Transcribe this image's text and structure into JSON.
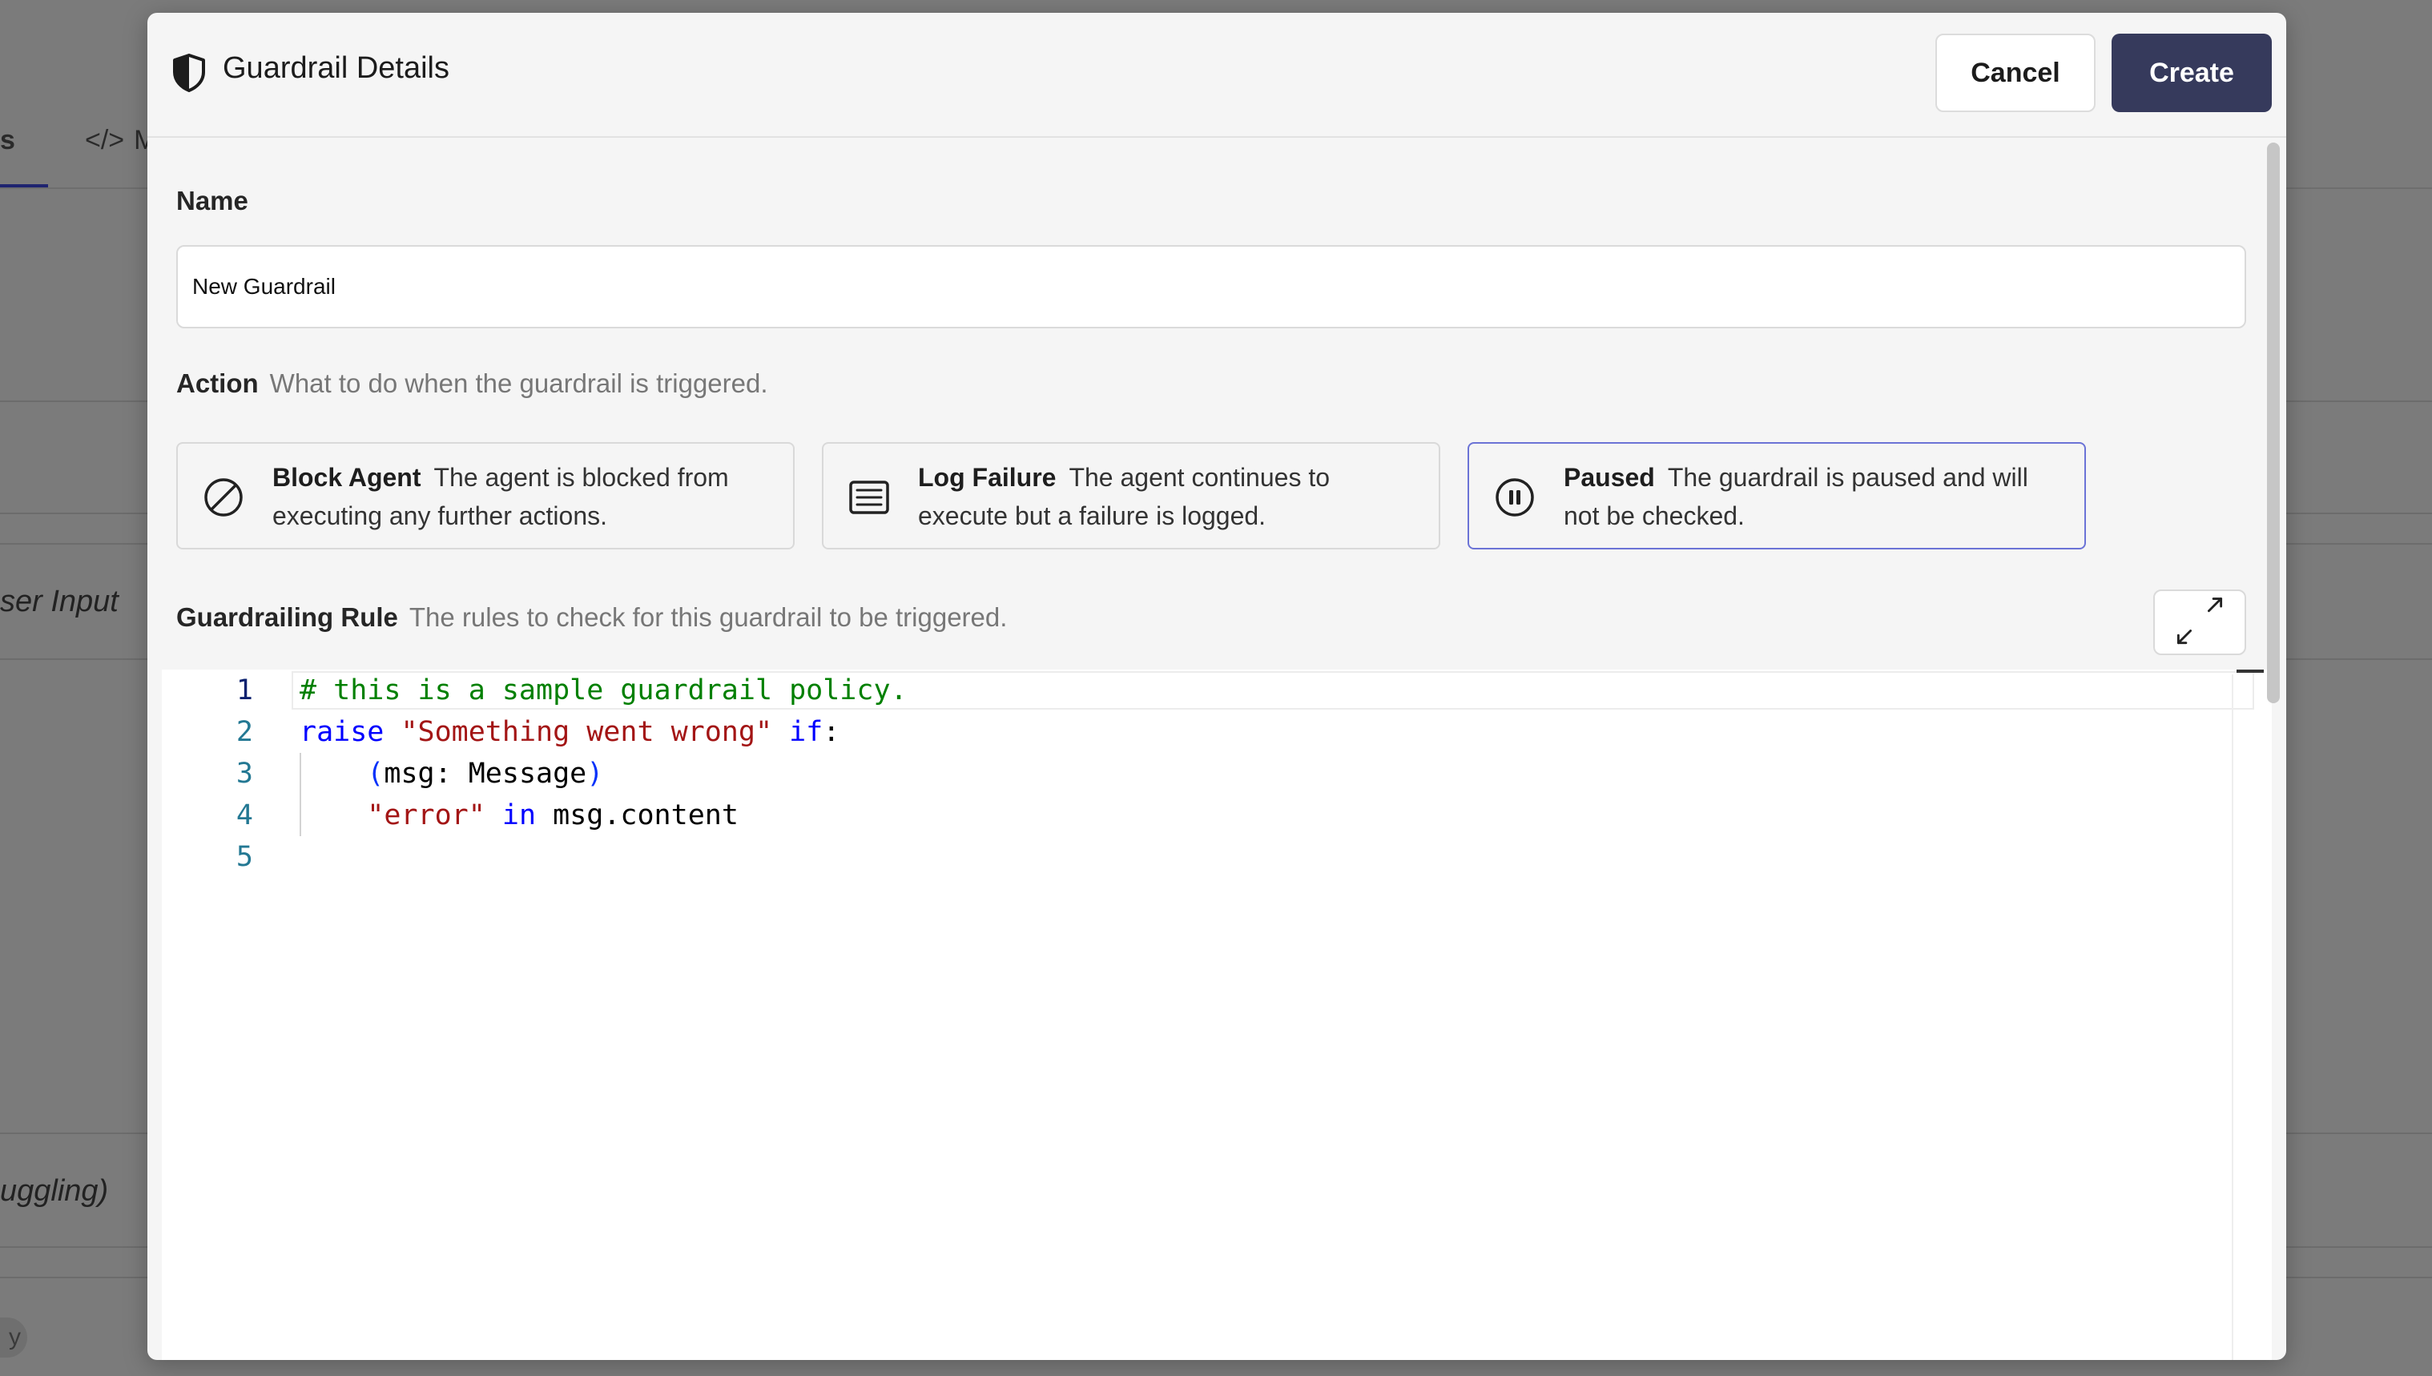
{
  "background": {
    "tab_partial": "s",
    "tab_code_partial": "M",
    "row1_text": "ser Input",
    "row2_text": "uggling)",
    "pill_text": "y"
  },
  "modal": {
    "title": "Guardrail Details",
    "cancel_label": "Cancel",
    "create_label": "Create",
    "name": {
      "label": "Name",
      "value": "New Guardrail"
    },
    "action": {
      "label": "Action",
      "hint": "What to do when the guardrail is triggered.",
      "options": [
        {
          "title": "Block Agent",
          "description": "The agent is blocked from executing any further actions.",
          "icon": "block-icon",
          "selected": false
        },
        {
          "title": "Log Failure",
          "description": "The agent continues to execute but a failure is logged.",
          "icon": "list-icon",
          "selected": false
        },
        {
          "title": "Paused",
          "description": "The guardrail is paused and will not be checked.",
          "icon": "pause-icon",
          "selected": true
        }
      ]
    },
    "rule": {
      "label": "Guardrailing Rule",
      "hint": "The rules to check for this guardrail to be triggered.",
      "line_numbers": [
        "1",
        "2",
        "3",
        "4",
        "5"
      ],
      "code_lines": [
        [
          {
            "t": "# this is a sample guardrail policy.",
            "k": "comment"
          }
        ],
        [
          {
            "t": "raise",
            "k": "kw"
          },
          {
            "t": " ",
            "k": "plain"
          },
          {
            "t": "\"Something went wrong\"",
            "k": "str"
          },
          {
            "t": " ",
            "k": "plain"
          },
          {
            "t": "if",
            "k": "kw"
          },
          {
            "t": ":",
            "k": "plain"
          }
        ],
        [
          {
            "t": "    ",
            "k": "plain"
          },
          {
            "t": "(",
            "k": "paren"
          },
          {
            "t": "msg: Message",
            "k": "plain"
          },
          {
            "t": ")",
            "k": "paren"
          }
        ],
        [
          {
            "t": "    ",
            "k": "plain"
          },
          {
            "t": "\"error\"",
            "k": "str"
          },
          {
            "t": " ",
            "k": "plain"
          },
          {
            "t": "in",
            "k": "kw"
          },
          {
            "t": " msg.content",
            "k": "plain"
          }
        ],
        []
      ]
    }
  },
  "colors": {
    "primary_button": "#363a5c",
    "selected_border": "#6b73d6",
    "comment": "#008000",
    "keyword": "#0000ff",
    "string": "#a31515",
    "line_number": "#237893"
  }
}
